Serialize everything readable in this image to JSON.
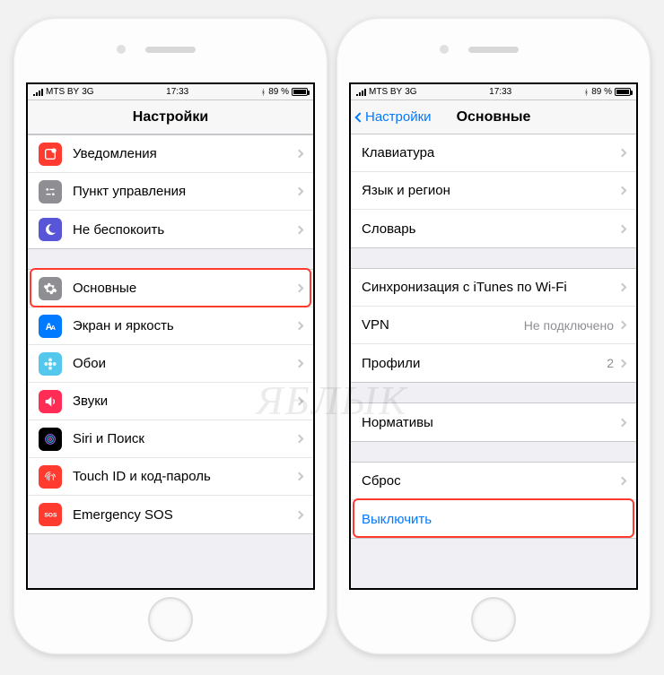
{
  "status": {
    "carrier": "MTS BY",
    "net": "3G",
    "time": "17:33",
    "battery": "89 %",
    "bluetooth": "✱"
  },
  "left": {
    "title": "Настройки",
    "g1": [
      {
        "id": "notifications",
        "label": "Уведомления"
      },
      {
        "id": "control-center",
        "label": "Пункт управления"
      },
      {
        "id": "dnd",
        "label": "Не беспокоить"
      }
    ],
    "g2": [
      {
        "id": "general",
        "label": "Основные",
        "hl": true
      },
      {
        "id": "display",
        "label": "Экран и яркость"
      },
      {
        "id": "wallpaper",
        "label": "Обои"
      },
      {
        "id": "sounds",
        "label": "Звуки"
      },
      {
        "id": "siri",
        "label": "Siri и Поиск"
      },
      {
        "id": "touchid",
        "label": "Touch ID и код-пароль"
      },
      {
        "id": "sos",
        "label": "Emergency SOS"
      }
    ]
  },
  "right": {
    "back": "Настройки",
    "title": "Основные",
    "g1": [
      {
        "id": "keyboard",
        "label": "Клавиатура"
      },
      {
        "id": "lang",
        "label": "Язык и регион"
      },
      {
        "id": "dict",
        "label": "Словарь"
      }
    ],
    "g2": [
      {
        "id": "itunes-wifi",
        "label": "Синхронизация с iTunes по Wi-Fi"
      },
      {
        "id": "vpn",
        "label": "VPN",
        "value": "Не подключено"
      },
      {
        "id": "profiles",
        "label": "Профили",
        "value": "2"
      }
    ],
    "g3": [
      {
        "id": "regulatory",
        "label": "Нормативы"
      }
    ],
    "g4": [
      {
        "id": "reset",
        "label": "Сброс"
      }
    ],
    "shutdown": "Выключить"
  },
  "watermark": "ЯБЛЫК"
}
